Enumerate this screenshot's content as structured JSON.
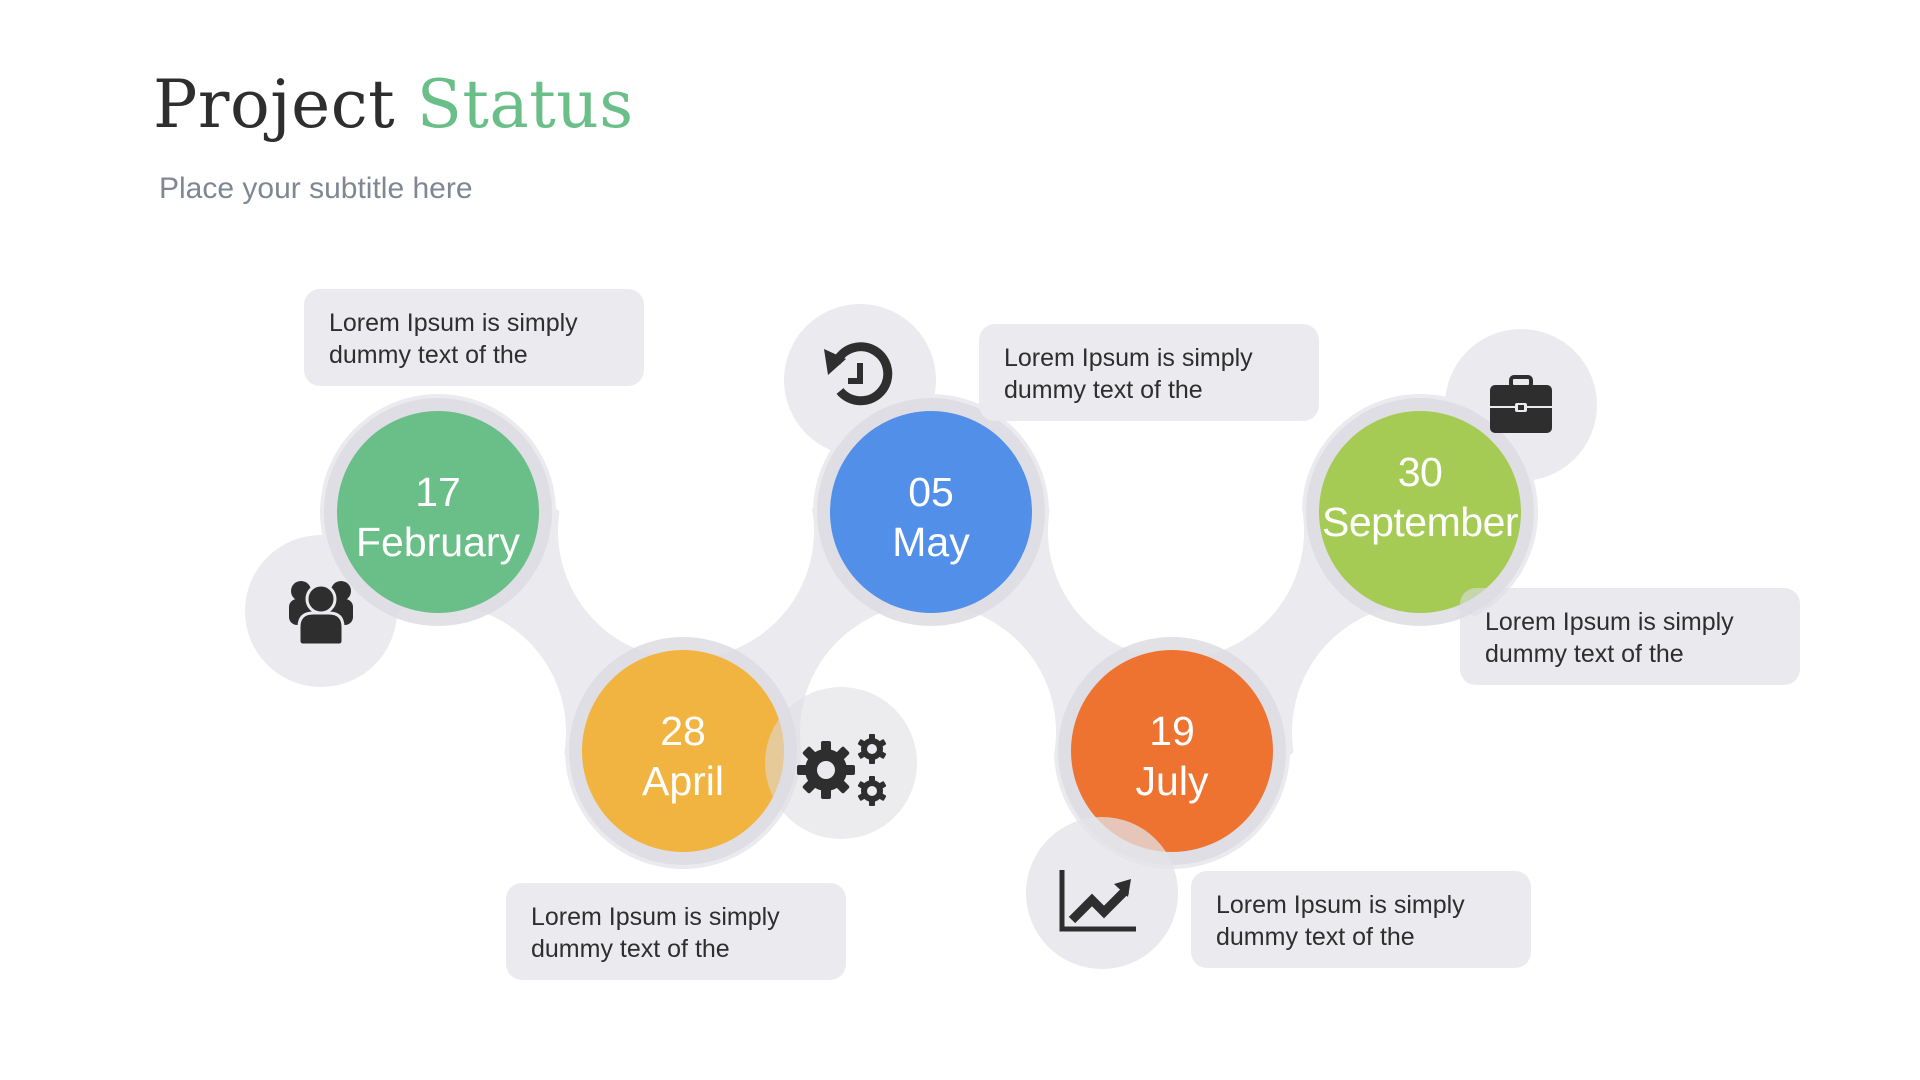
{
  "header": {
    "title_main": "Project",
    "title_accent": "Status",
    "subtitle": "Place your subtitle here"
  },
  "colors": {
    "title": "#2e2e2e",
    "accent": "#6abf88",
    "subtitle": "#7f8794",
    "band": "#ebebef",
    "halo": "#dcdce2",
    "icon": "#2e2e2e"
  },
  "milestones": [
    {
      "day": "17",
      "month": "February",
      "color": "#6abf88",
      "icon": "users-icon",
      "text_line1": "Lorem Ipsum is simply",
      "text_line2": "dummy text of the"
    },
    {
      "day": "28",
      "month": "April",
      "color": "#f2b440",
      "icon": "gears-icon",
      "text_line1": "Lorem Ipsum is simply",
      "text_line2": "dummy text of the"
    },
    {
      "day": "05",
      "month": "May",
      "color": "#528fe8",
      "icon": "history-icon",
      "text_line1": "Lorem Ipsum is simply",
      "text_line2": "dummy text of the"
    },
    {
      "day": "19",
      "month": "July",
      "color": "#ee7330",
      "icon": "trend-chart-icon",
      "text_line1": "Lorem Ipsum is simply",
      "text_line2": "dummy text of the"
    },
    {
      "day": "30",
      "month": "September",
      "color": "#a5cb55",
      "icon": "briefcase-icon",
      "text_line1": "Lorem Ipsum is simply",
      "text_line2": "dummy text of the"
    }
  ]
}
